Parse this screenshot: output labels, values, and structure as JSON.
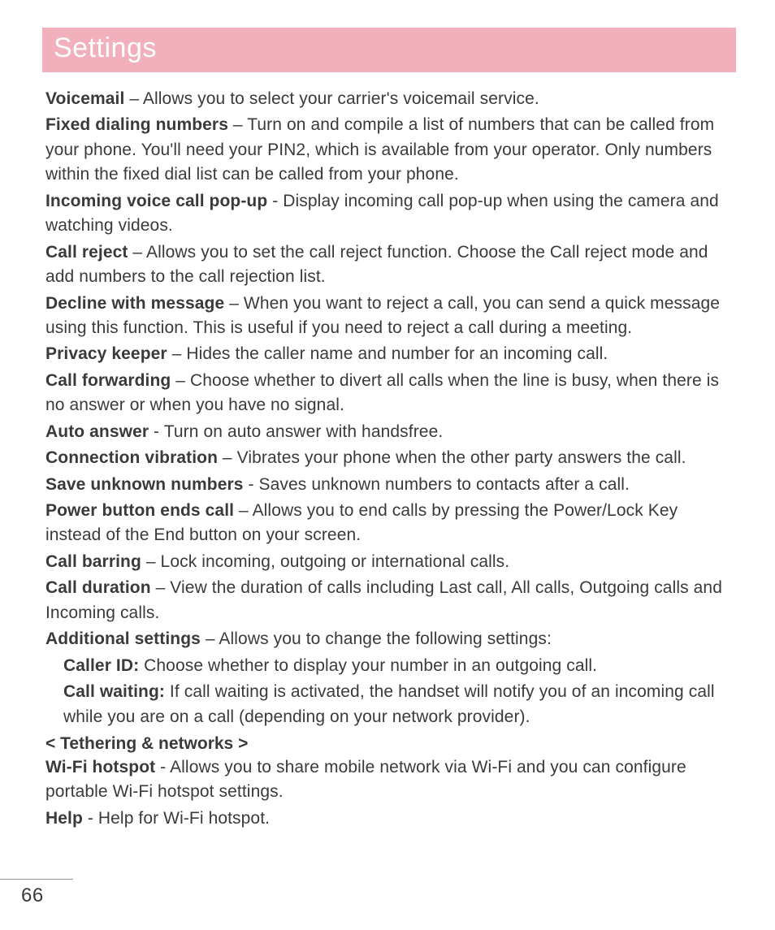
{
  "title": "Settings",
  "entries": [
    {
      "term": "Voicemail",
      "sep": " – ",
      "desc": "Allows you to select your carrier's voicemail service."
    },
    {
      "term": "Fixed dialing numbers",
      "sep": " – ",
      "desc": "Turn on and compile a list of numbers that can be called from your phone. You'll need your PIN2, which is available from your operator. Only numbers within the fixed dial list can be called from your phone."
    },
    {
      "term": "Incoming voice call pop-up",
      "sep": " - ",
      "desc": "Display incoming call pop-up when using the camera and watching videos."
    },
    {
      "term": "Call reject",
      "sep": " – ",
      "desc": "Allows you to set the call reject function. Choose the Call reject mode and add numbers to the call rejection list."
    },
    {
      "term": "Decline with message",
      "sep": " – ",
      "desc": "When you want to reject a call, you can send a quick message using this function. This is useful if you need to reject a call during a meeting."
    },
    {
      "term": "Privacy keeper",
      "sep": " – ",
      "desc": "Hides the caller name and number for an incoming call."
    },
    {
      "term": "Call forwarding",
      "sep": " – ",
      "desc": "Choose whether to divert all calls when the line is busy, when there is no answer or when you have no signal."
    },
    {
      "term": "Auto answer",
      "sep": " - ",
      "desc": "Turn on auto answer with handsfree."
    },
    {
      "term": "Connection vibration",
      "sep": " – ",
      "desc": "Vibrates your phone when the other party answers the call."
    },
    {
      "term": "Save unknown numbers",
      "sep": " - ",
      "desc": "Saves unknown numbers to contacts after a call."
    },
    {
      "term": "Power button ends call",
      "sep": " – ",
      "desc": "Allows you to end calls by pressing the Power/Lock Key instead of the End button on your screen."
    },
    {
      "term": "Call barring",
      "sep": " – ",
      "desc": "Lock incoming, outgoing or international calls."
    },
    {
      "term": "Call duration",
      "sep": " – ",
      "desc": "View the duration of calls including Last call, All calls, Outgoing calls and Incoming calls."
    },
    {
      "term": "Additional settings",
      "sep": " – ",
      "desc": "Allows you to change the following settings:"
    }
  ],
  "sub_entries": [
    {
      "term": "Caller ID:",
      "sep": " ",
      "desc": "Choose whether to display your number in an outgoing call."
    },
    {
      "term": "Call waiting:",
      "sep": " ",
      "desc": "If call waiting is activated, the handset will notify you of an incoming call while you are on a call (depending on your network provider)."
    }
  ],
  "section_head": "< Tethering & networks >",
  "tethering_entries": [
    {
      "term": "Wi-Fi hotspot",
      "sep": " - ",
      "desc": "Allows you to share mobile network via Wi-Fi and you can configure portable Wi-Fi hotspot settings."
    },
    {
      "term": "Help",
      "sep": " - ",
      "desc": "Help for Wi-Fi hotspot."
    }
  ],
  "page_number": "66"
}
